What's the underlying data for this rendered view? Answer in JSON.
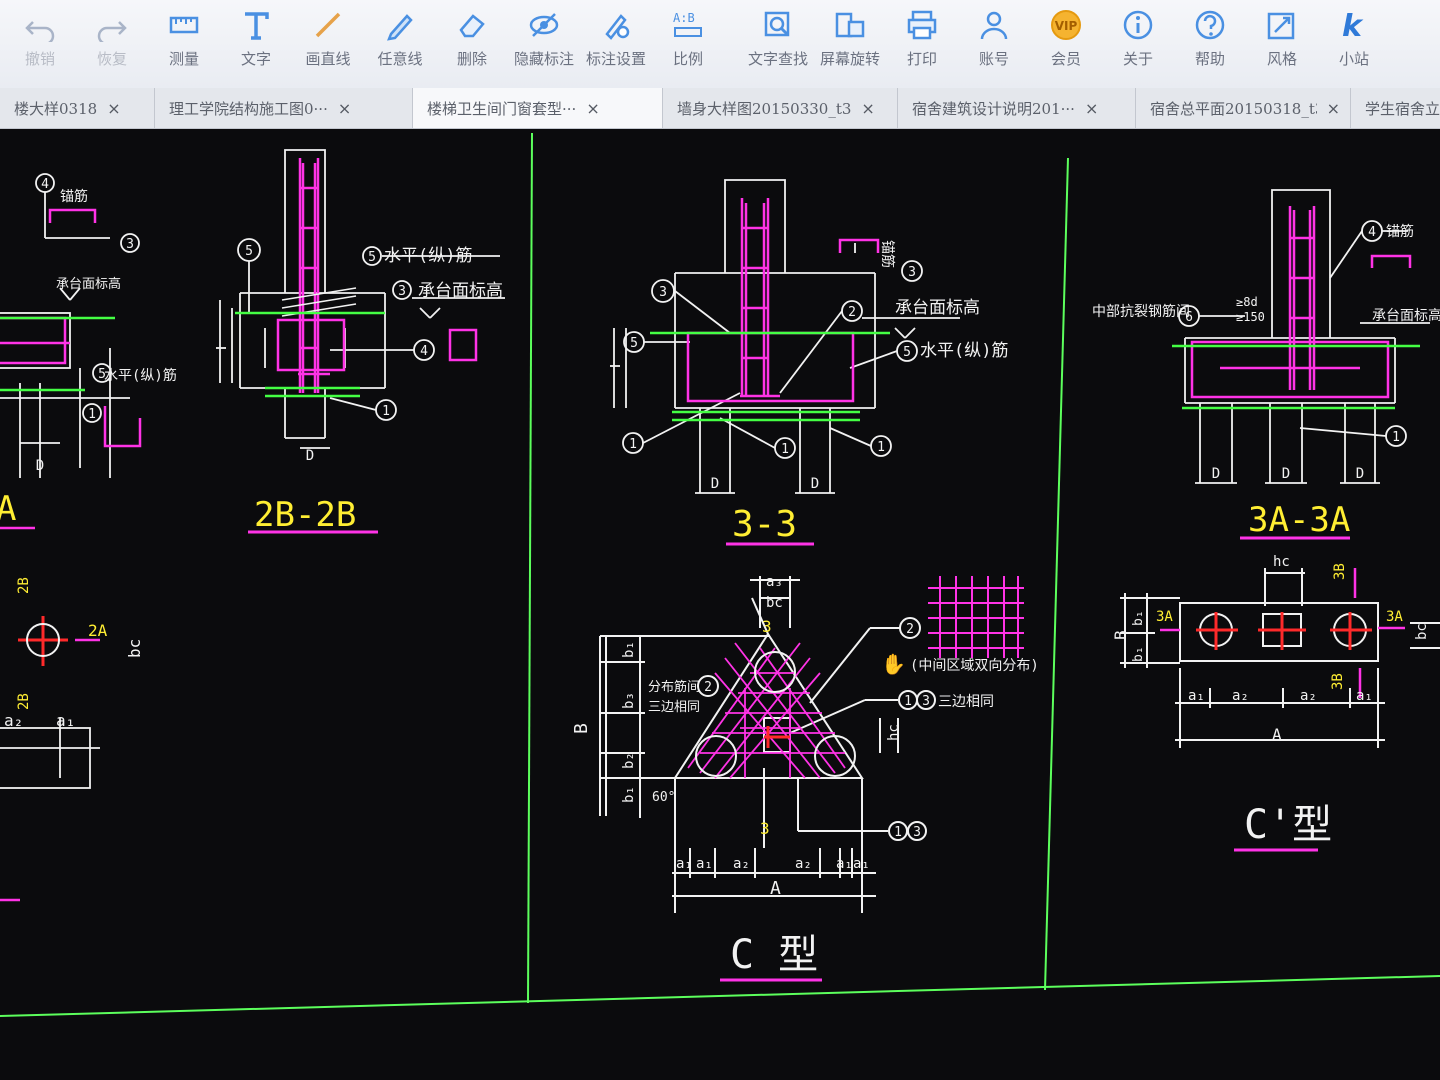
{
  "toolbar": {
    "items": [
      {
        "label": "撤销",
        "icon": "undo-icon"
      },
      {
        "label": "恢复",
        "icon": "redo-icon"
      },
      {
        "label": "测量",
        "icon": "measure-icon"
      },
      {
        "label": "文字",
        "icon": "text-icon"
      },
      {
        "label": "画直线",
        "icon": "line-icon"
      },
      {
        "label": "任意线",
        "icon": "pen-icon"
      },
      {
        "label": "删除",
        "icon": "eraser-icon"
      },
      {
        "label": "隐藏标注",
        "icon": "hide-annotation-icon"
      },
      {
        "label": "标注设置",
        "icon": "annotation-settings-icon"
      },
      {
        "label": "比例",
        "icon": "scale-icon"
      },
      {
        "label": "文字查找",
        "icon": "text-search-icon"
      },
      {
        "label": "屏幕旋转",
        "icon": "rotate-screen-icon"
      },
      {
        "label": "打印",
        "icon": "print-icon"
      },
      {
        "label": "账号",
        "icon": "account-icon"
      },
      {
        "label": "会员",
        "icon": "vip-icon"
      },
      {
        "label": "关于",
        "icon": "info-icon"
      },
      {
        "label": "帮助",
        "icon": "help-icon"
      },
      {
        "label": "风格",
        "icon": "style-icon"
      },
      {
        "label": "小站",
        "icon": "k-logo-icon"
      }
    ],
    "vip_badge": "VIP",
    "scale_badge": "A:B"
  },
  "tabs": [
    {
      "label": "楼大样0318",
      "active": false
    },
    {
      "label": "理工学院结构施工图0···",
      "active": false
    },
    {
      "label": "楼梯卫生间门窗套型···",
      "active": true
    },
    {
      "label": "墙身大样图20150330_t3",
      "active": false
    },
    {
      "label": "宿舍建筑设计说明201···",
      "active": false
    },
    {
      "label": "宿舍总平面20150318_t3",
      "active": false
    },
    {
      "label": "学生宿舍立",
      "active": false
    }
  ],
  "tab_close": "×",
  "drawing": {
    "section_titles": {
      "left_partial": "A",
      "s2b": "2B-2B",
      "s33": "3-3",
      "s3a": "3A-3A",
      "type_c": "C 型",
      "type_c_prime": "C'型"
    },
    "annotations": {
      "water_rebar": "水平(纵)筋",
      "bearing_elev": "承台面标高",
      "anchor_rebar": "锚筋",
      "mid_zone": "(中间区域双向分布)",
      "three_side_same": "三边相同",
      "dist_rebar_spacing": "分布筋间",
      "middle_rebar_spacing": "中部抗裂钢筋间",
      "ge8d": "≥8d",
      "ge150": "≥150",
      "angle": "60°"
    },
    "dims": {
      "A": "A",
      "B": "B",
      "bc": "bc",
      "hc": "hc",
      "a1": "a₁",
      "a2": "a₂",
      "a3": "a₃",
      "b1": "b₁",
      "b2": "b₂",
      "b3": "b₃",
      "d": "D",
      "mark_2A": "2A",
      "mark_2B": "2B",
      "mark_3": "3",
      "mark_3A": "3A",
      "mark_3B": "3B"
    },
    "markers": [
      "1",
      "2",
      "3",
      "4",
      "5",
      "6"
    ]
  },
  "colors": {
    "magenta": "#ff33e6",
    "white": "#f2f2f2",
    "yellow": "#ffee33",
    "green": "#44ff44",
    "red": "#ff2a2a",
    "border_green": "#5cff5c"
  }
}
